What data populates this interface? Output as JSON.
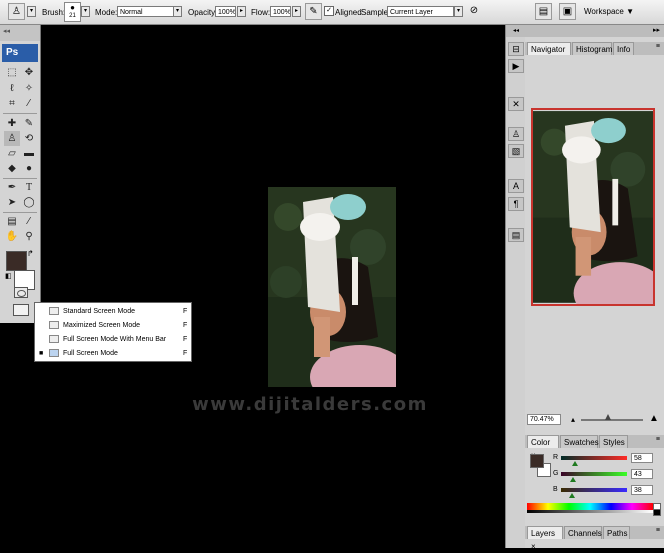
{
  "options_bar": {
    "brush_label": "Brush:",
    "brush_size": "21",
    "mode_label": "Mode:",
    "mode_value": "Normal",
    "opacity_label": "Opacity:",
    "opacity_value": "100%",
    "flow_label": "Flow:",
    "flow_value": "100%",
    "aligned_label": "Aligned",
    "sample_label": "Sample:",
    "sample_value": "Current Layer",
    "workspace_label": "Workspace"
  },
  "toolbox": {
    "logo": "Ps"
  },
  "screen_mode_menu": {
    "items": [
      {
        "label": "Standard Screen Mode",
        "shortcut": "F"
      },
      {
        "label": "Maximized Screen Mode",
        "shortcut": "F"
      },
      {
        "label": "Full Screen Mode With Menu Bar",
        "shortcut": "F"
      },
      {
        "label": "Full Screen Mode",
        "shortcut": "F"
      }
    ],
    "bullet": "■"
  },
  "watermark": "www.dijitalders.com",
  "navigator": {
    "tabs": [
      "Navigator",
      "Histogram",
      "Info"
    ],
    "zoom": "70.47%"
  },
  "color_panel": {
    "tabs": [
      "Color",
      "Swatches",
      "Styles"
    ],
    "channels": [
      {
        "name": "R",
        "value": "58"
      },
      {
        "name": "G",
        "value": "43"
      },
      {
        "name": "B",
        "value": "38"
      }
    ],
    "foreground": "#3a2b26"
  },
  "layers_panel": {
    "tabs": [
      "Layers",
      "Channels",
      "Paths"
    ]
  }
}
